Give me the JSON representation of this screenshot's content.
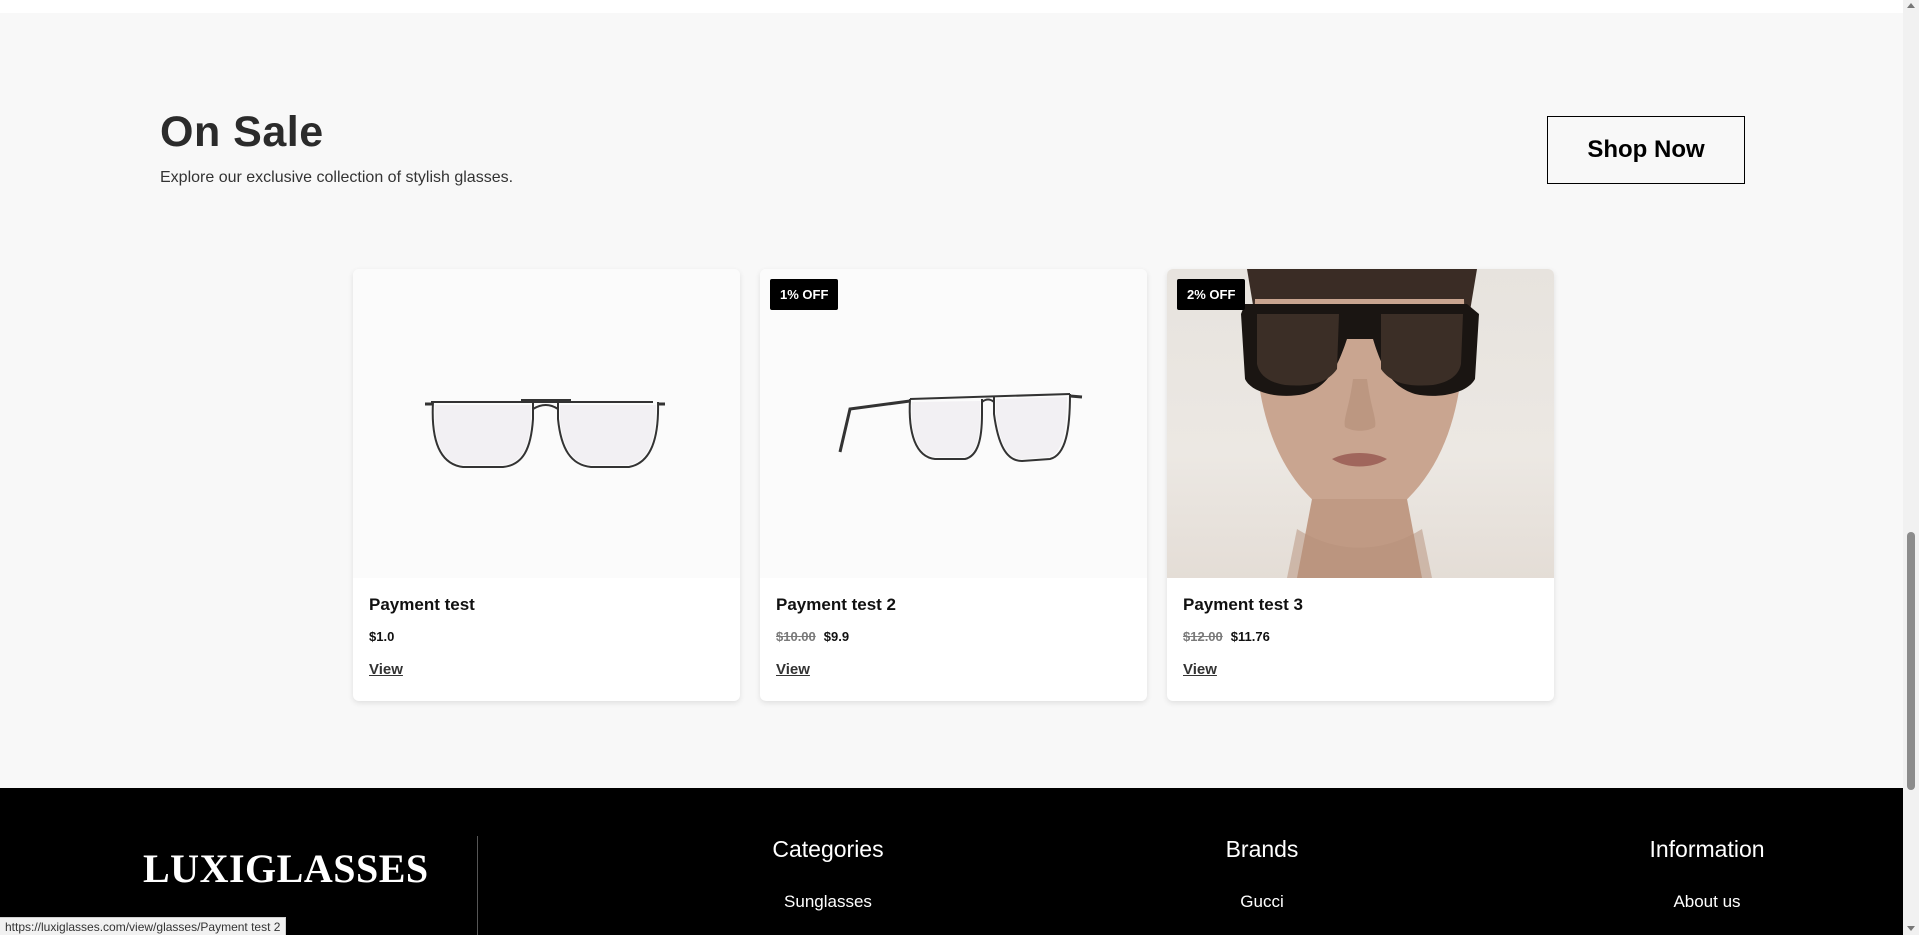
{
  "sale": {
    "title": "On Sale",
    "subtitle": "Explore our exclusive collection of stylish glasses.",
    "shop_now_label": "Shop Now"
  },
  "products": [
    {
      "badge": "",
      "name": "Payment test",
      "old_price": "",
      "price": "$1.0",
      "link_label": "View",
      "image": "aviator-eyeglasses-front"
    },
    {
      "badge": "1% OFF",
      "name": "Payment test 2",
      "old_price": "$10.00",
      "price": "$9.9",
      "link_label": "View",
      "image": "aviator-eyeglasses-angled"
    },
    {
      "badge": "2% OFF",
      "name": "Payment test 3",
      "old_price": "$12.00",
      "price": "$11.76",
      "link_label": "View",
      "image": "model-wearing-black-sunglasses"
    }
  ],
  "footer": {
    "logo": "LUXIGLASSES",
    "columns": [
      {
        "title": "Categories",
        "first_link": "Sunglasses"
      },
      {
        "title": "Brands",
        "first_link": "Gucci"
      },
      {
        "title": "Information",
        "first_link": "About us"
      }
    ]
  },
  "status_bar": {
    "url": "https://luxiglasses.com/view/glasses/Payment test 2"
  }
}
